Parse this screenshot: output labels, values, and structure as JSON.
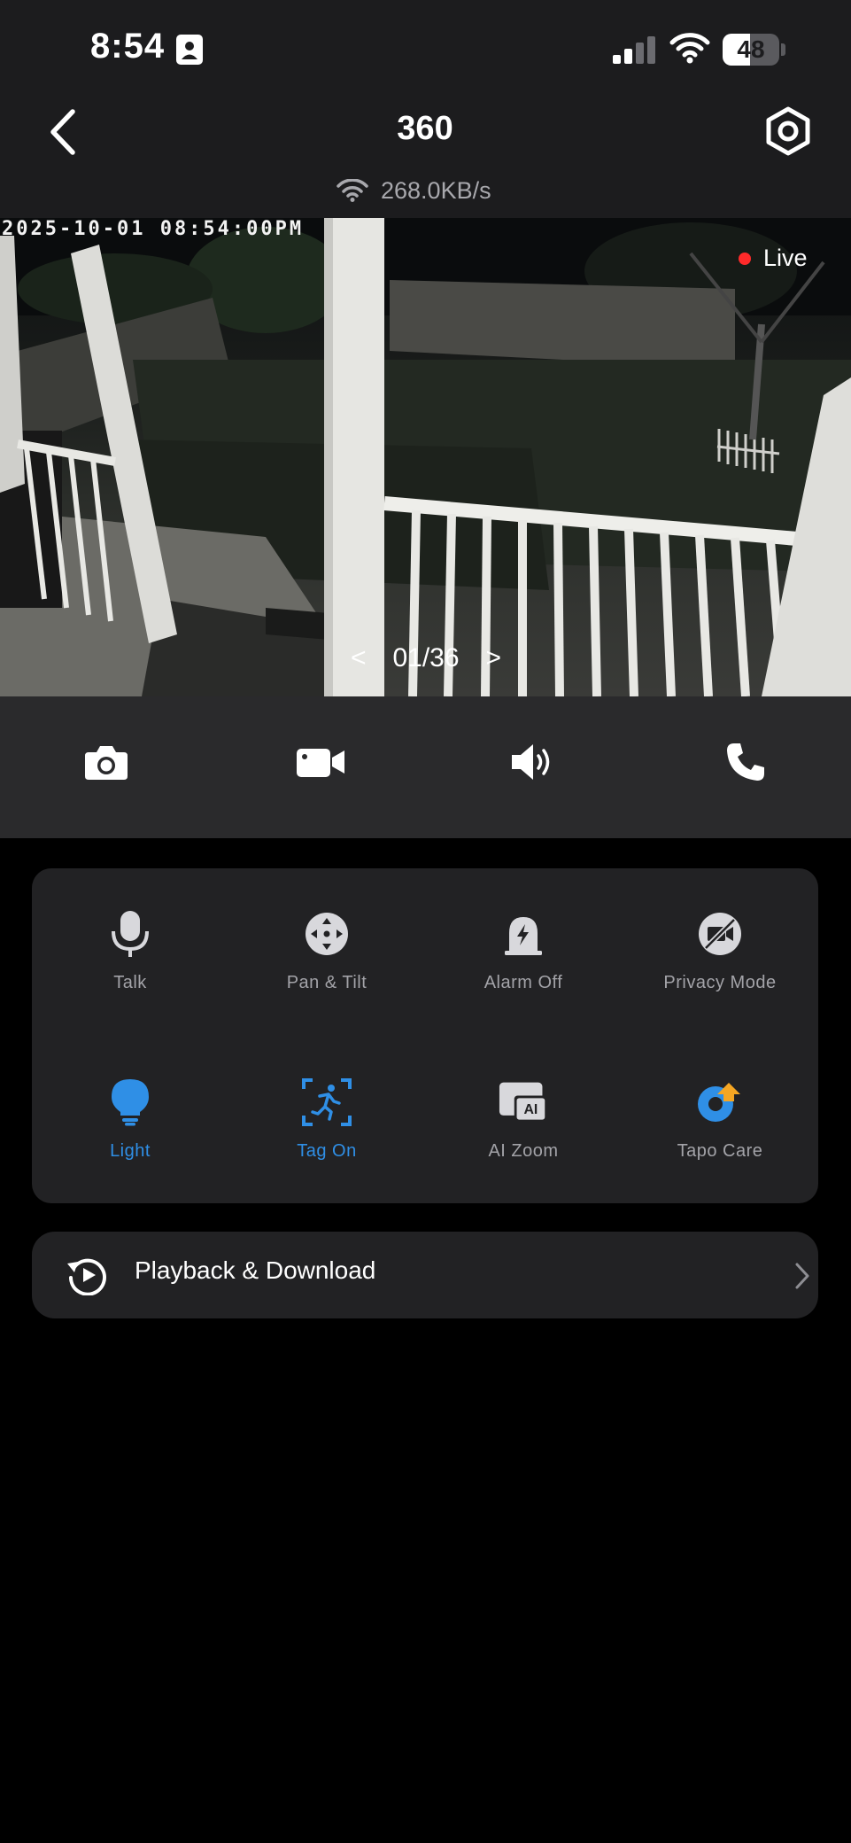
{
  "status_bar": {
    "time": "8:54",
    "battery": "48",
    "battery_level": 0.48
  },
  "header": {
    "title": "360",
    "speed": "268.0KB/s"
  },
  "video": {
    "timestamp": "2025-10-01 08:54:00PM",
    "live_label": "Live",
    "pager": "01/36",
    "prev_arrow": "<",
    "next_arrow": ">"
  },
  "controls": {
    "icons": [
      "camera-icon",
      "video-record-icon",
      "speaker-icon",
      "phone-icon"
    ]
  },
  "features": [
    {
      "label": "Talk",
      "icon": "microphone-icon",
      "active": false
    },
    {
      "label": "Pan & Tilt",
      "icon": "pan-tilt-icon",
      "active": false
    },
    {
      "label": "Alarm Off",
      "icon": "alarm-icon",
      "active": false
    },
    {
      "label": "Privacy Mode",
      "icon": "privacy-mode-icon",
      "active": false
    },
    {
      "label": "Light",
      "icon": "light-bulb-icon",
      "active": true
    },
    {
      "label": "Tag On",
      "icon": "tag-motion-icon",
      "active": true
    },
    {
      "label": "AI Zoom",
      "icon": "ai-zoom-icon",
      "active": false
    },
    {
      "label": "Tapo Care",
      "icon": "tapo-care-icon",
      "active": false
    }
  ],
  "playback": {
    "label": "Playback & Download"
  },
  "colors": {
    "accent": "#2f8fe6",
    "live_dot": "#ff2a2a",
    "tapo_care_badge": "#f5a623",
    "panel": "#222224",
    "controls_bar": "#2a2a2c",
    "header": "#1c1c1e"
  }
}
